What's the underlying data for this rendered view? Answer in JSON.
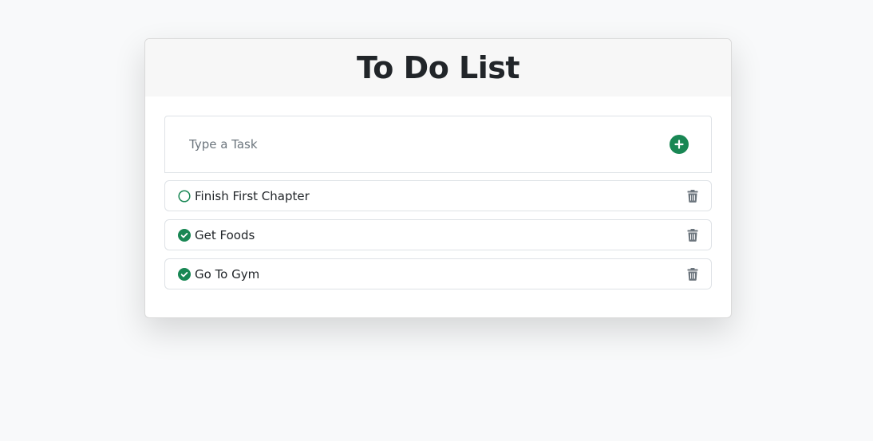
{
  "header": {
    "title": "To Do List"
  },
  "input": {
    "placeholder": "Type a Task",
    "value": ""
  },
  "colors": {
    "accent": "#198754",
    "trash": "#6c757d"
  },
  "icons": {
    "add": "plus-circle-icon",
    "done": "check-circle-icon",
    "pending": "circle-outline-icon",
    "delete": "trash-icon"
  },
  "tasks": [
    {
      "label": "Finish First Chapter",
      "done": false
    },
    {
      "label": "Get Foods",
      "done": true
    },
    {
      "label": "Go To Gym",
      "done": true
    }
  ]
}
